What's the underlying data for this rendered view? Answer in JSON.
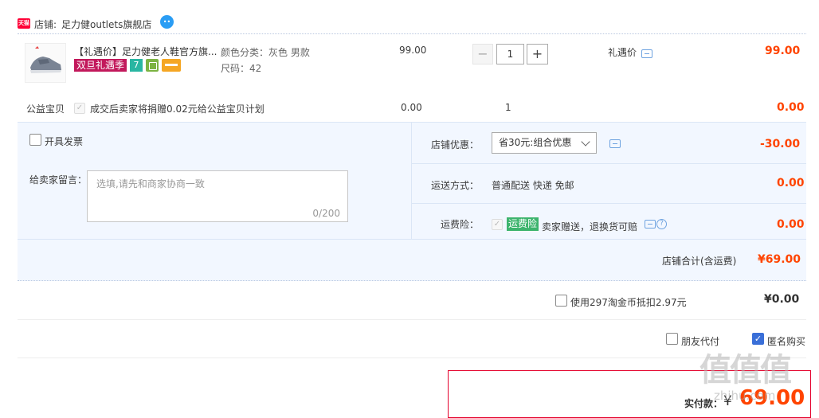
{
  "shop": {
    "logo_text": "天猫",
    "label": "店铺:",
    "name": "足力健outlets旗舰店",
    "wangwang_icon": "wangwang-chat-icon"
  },
  "item": {
    "title": "【礼遇价】足力健老人鞋官方旗...",
    "promo_tag": "双旦礼遇季",
    "badge_7": "7",
    "sku_color": "颜色分类：灰色 男款",
    "sku_size": "尺码：42",
    "unit_price": "99.00",
    "quantity": "1",
    "minus": "−",
    "plus": "+",
    "price_label": "礼遇价",
    "subtotal": "99.00"
  },
  "charity": {
    "label": "公益宝贝",
    "desc": "成交后卖家将捐赠0.02元给公益宝贝计划",
    "price": "0.00",
    "quantity": "1",
    "subtotal": "0.00"
  },
  "invoice": {
    "label": "开具发票"
  },
  "message": {
    "label": "给卖家留言：",
    "placeholder": "选填,请先和商家协商一致",
    "counter": "0/200"
  },
  "discount": {
    "label": "店铺优惠：",
    "selected": "省30元:组合优惠",
    "amount": "-30.00"
  },
  "shipping": {
    "label": "运送方式：",
    "value": "普通配送 快递 免邮",
    "amount": "0.00"
  },
  "insurance": {
    "label": "运费险：",
    "tag": "运费险",
    "desc": "卖家赠送，退换货可赔",
    "help": "?",
    "amount": "0.00"
  },
  "shop_total": {
    "label": "店铺合计(含运费)",
    "amount": "¥69.00"
  },
  "coins": {
    "label": "使用297淘金币抵扣2.97元",
    "amount": "¥0.00"
  },
  "options": {
    "friend_pay": "朋友代付",
    "anonymous": "匿名购买",
    "check": "✓"
  },
  "payment": {
    "label": "实付款：",
    "currency": "¥",
    "amount": "69.00"
  },
  "watermark": {
    "logo": "值值值",
    "site": "zhihu.com"
  }
}
